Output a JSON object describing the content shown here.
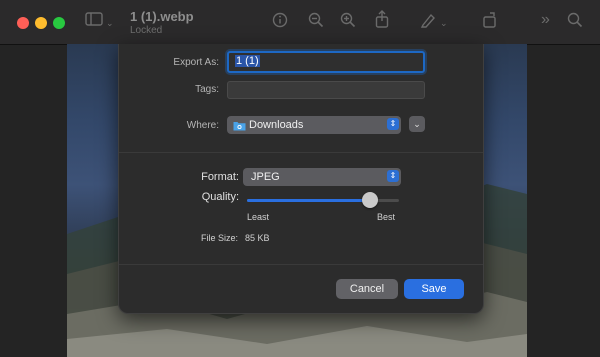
{
  "window": {
    "title": "1 (1).webp",
    "subtitle": "Locked"
  },
  "toolbar_icons": [
    "sidebar-icon",
    "info-icon",
    "zoom-out-icon",
    "zoom-in-icon",
    "share-icon",
    "markup-icon",
    "rotate-icon",
    "more-icon",
    "search-icon"
  ],
  "dialog": {
    "export_as_label": "Export As:",
    "export_as_value": "1 (1)",
    "tags_label": "Tags:",
    "tags_value": "",
    "where_label": "Where:",
    "where_value": "Downloads",
    "format_label": "Format:",
    "format_value": "JPEG",
    "quality_label": "Quality:",
    "quality_level": 0.81,
    "quality_min_label": "Least",
    "quality_max_label": "Best",
    "file_size_label": "File Size:",
    "file_size_value": "85 KB",
    "cancel_label": "Cancel",
    "save_label": "Save"
  },
  "colors": {
    "accent": "#2a6fe0",
    "close": "#fe5f57",
    "minimize": "#febc2e",
    "maximize": "#28c840"
  }
}
